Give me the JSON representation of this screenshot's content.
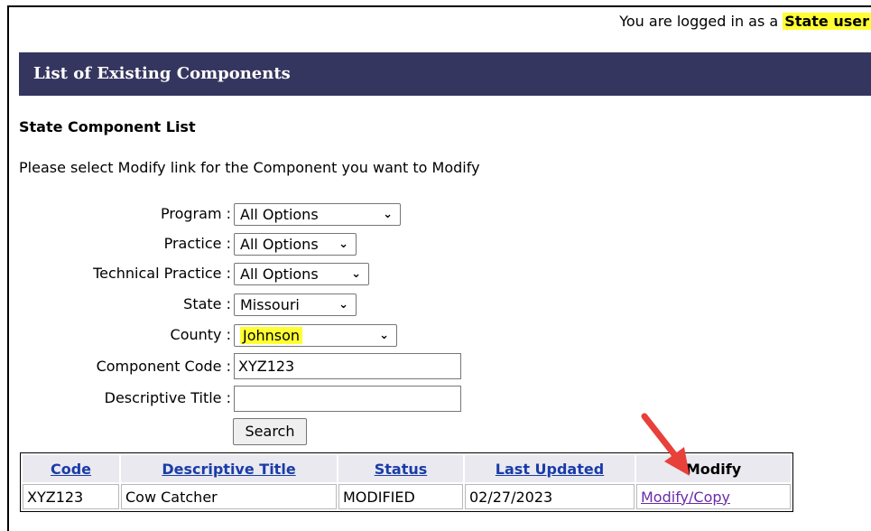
{
  "login": {
    "prefix": "You are logged in as a",
    "role": "State user"
  },
  "header": {
    "title": "List of Existing Components"
  },
  "section": {
    "title": "State Component List",
    "instruction": "Please select Modify link for the Component you want to Modify"
  },
  "form": {
    "program": {
      "label": "Program :",
      "value": "All Options"
    },
    "practice": {
      "label": "Practice :",
      "value": "All Options"
    },
    "technical_practice": {
      "label": "Technical Practice :",
      "value": "All Options"
    },
    "state": {
      "label": "State :",
      "value": "Missouri"
    },
    "county": {
      "label": "County :",
      "value": "Johnson"
    },
    "component_code": {
      "label": "Component Code :",
      "value": "XYZ123"
    },
    "descriptive_title": {
      "label": "Descriptive Title :",
      "value": ""
    },
    "search_label": "Search"
  },
  "table": {
    "headers": [
      "Code",
      "Descriptive Title",
      "Status",
      "Last Updated",
      "Modify"
    ],
    "rows": [
      {
        "code": "XYZ123",
        "title": "Cow Catcher",
        "status": "MODIFIED",
        "updated": "02/27/2023",
        "modify": "Modify/Copy"
      }
    ]
  },
  "colors": {
    "title_bar": "#35365f",
    "highlight": "#ffff33",
    "arrow": "#e8403a"
  }
}
